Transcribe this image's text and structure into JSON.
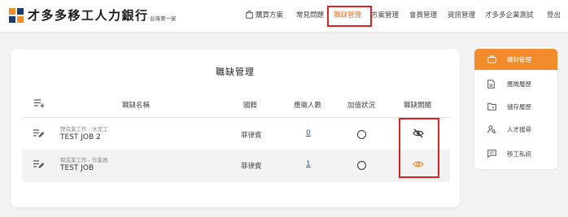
{
  "header": {
    "brand": "才多多移工人力銀行",
    "slogan": "台灣第一家",
    "nav": {
      "buy_plan": "購買方案",
      "faq": "常見問題",
      "job_mgmt": "職缺管理",
      "plan_mgmt": "方案管理",
      "member_mgmt": "會員管理",
      "info_mgmt": "資訊管理",
      "company_test": "才多多企業測試",
      "logout": "登出"
    }
  },
  "main": {
    "title": "職缺管理",
    "columns": {
      "job_name": "職缺名稱",
      "nationality": "國籍",
      "applicants": "應徵人數",
      "favorite": "加值狀況",
      "visibility": "職缺開關"
    },
    "rows": [
      {
        "category": "營造業工作 - 水泥工",
        "name": "TEST JOB 2",
        "nationality": "菲律賓",
        "applicants": "0",
        "visibility": "hidden"
      },
      {
        "category": "製造業工作 - 作業員",
        "name": "TEST JOB",
        "nationality": "菲律賓",
        "applicants": "1",
        "visibility": "visible"
      }
    ]
  },
  "sidebar": {
    "items": [
      {
        "label": "職缺管理",
        "icon": "briefcase-icon",
        "active": true
      },
      {
        "label": "應徵履歷",
        "icon": "document-icon",
        "active": false
      },
      {
        "label": "儲存履歷",
        "icon": "folder-icon",
        "active": false
      },
      {
        "label": "人才搜尋",
        "icon": "person-search-icon",
        "active": false
      },
      {
        "label": "移工私訊",
        "icon": "chat-icon",
        "active": false
      }
    ]
  },
  "colors": {
    "accent": "#f28b2b",
    "active_nav": "#e8762d",
    "highlight_border": "#d62323",
    "link": "#1e5aa8"
  }
}
